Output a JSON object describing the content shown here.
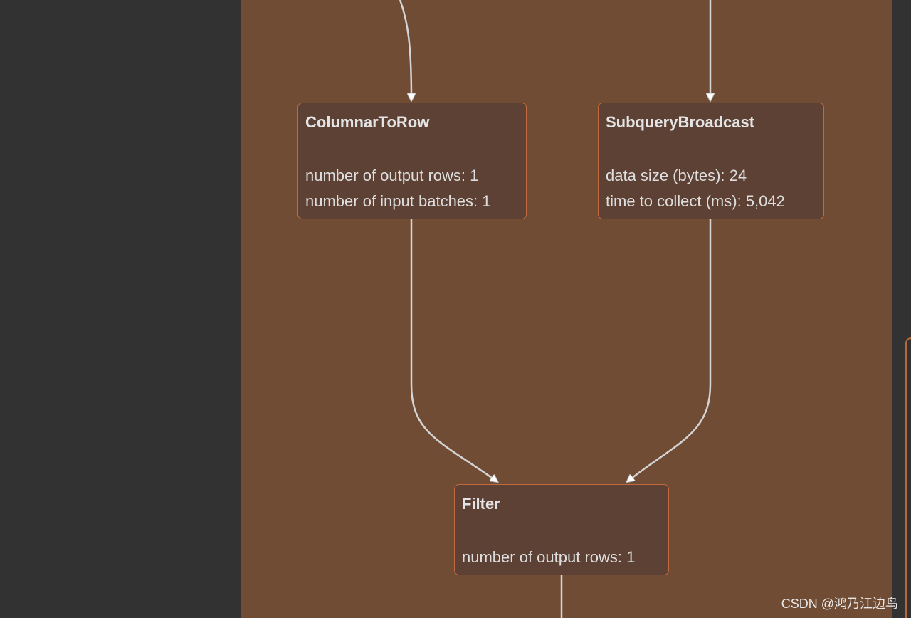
{
  "nodes": [
    {
      "title": "ColumnarToRow",
      "metrics": [
        "number of output rows: 1",
        "number of input batches: 1"
      ]
    },
    {
      "title": "SubqueryBroadcast",
      "metrics": [
        "data size (bytes): 24",
        "time to collect (ms): 5,042"
      ]
    },
    {
      "title": "Filter",
      "metrics": [
        "number of output rows: 1"
      ]
    }
  ],
  "watermark": "CSDN @鸿乃江边鸟",
  "colors": {
    "background": "#323232",
    "cluster_fill": "#714c35",
    "cluster_border": "#b5683d",
    "node_fill": "#5c4134",
    "node_border": "#c26a3f",
    "edge": "#d9d9d9",
    "text": "#dedede"
  }
}
